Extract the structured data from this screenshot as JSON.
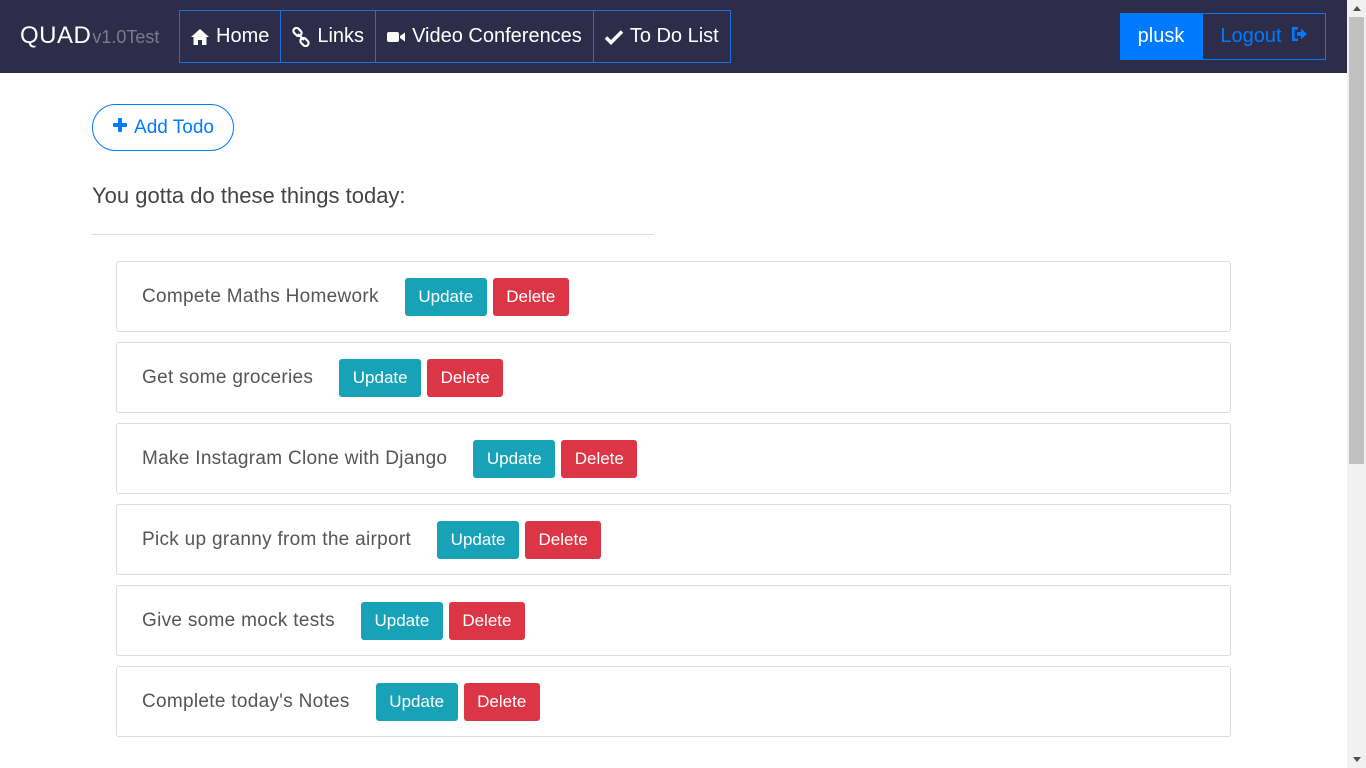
{
  "navbar": {
    "brand": "QUAD",
    "version": "v1.0Test",
    "links": [
      {
        "label": "Home",
        "icon": "home-icon"
      },
      {
        "label": "Links",
        "icon": "link-icon"
      },
      {
        "label": "Video Conferences",
        "icon": "video-icon"
      },
      {
        "label": "To Do List",
        "icon": "check-icon"
      }
    ],
    "username": "plusk",
    "logout_label": "Logout",
    "colors": {
      "background": "#2d2d4a",
      "accent": "#007bff"
    }
  },
  "main": {
    "add_todo_label": "Add Todo",
    "heading": "You gotta do these things today:",
    "update_label": "Update",
    "delete_label": "Delete",
    "todos": [
      {
        "text": "Compete Maths Homework"
      },
      {
        "text": "Get some groceries"
      },
      {
        "text": "Make Instagram Clone with Django"
      },
      {
        "text": "Pick up granny from the airport"
      },
      {
        "text": "Give some mock tests"
      },
      {
        "text": "Complete today's Notes"
      }
    ],
    "colors": {
      "update": "#17a2b8",
      "delete": "#dc3545"
    }
  }
}
